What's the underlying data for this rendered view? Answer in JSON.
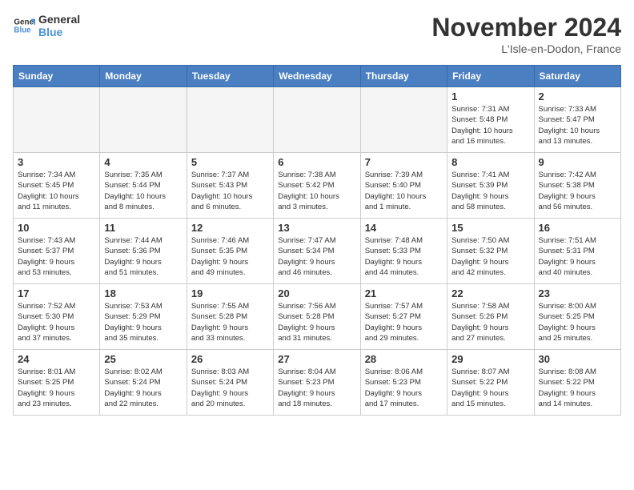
{
  "header": {
    "logo_general": "General",
    "logo_blue": "Blue",
    "month_title": "November 2024",
    "location": "L'Isle-en-Dodon, France"
  },
  "days_of_week": [
    "Sunday",
    "Monday",
    "Tuesday",
    "Wednesday",
    "Thursday",
    "Friday",
    "Saturday"
  ],
  "weeks": [
    [
      {
        "day": "",
        "info": ""
      },
      {
        "day": "",
        "info": ""
      },
      {
        "day": "",
        "info": ""
      },
      {
        "day": "",
        "info": ""
      },
      {
        "day": "",
        "info": ""
      },
      {
        "day": "1",
        "info": "Sunrise: 7:31 AM\nSunset: 5:48 PM\nDaylight: 10 hours\nand 16 minutes."
      },
      {
        "day": "2",
        "info": "Sunrise: 7:33 AM\nSunset: 5:47 PM\nDaylight: 10 hours\nand 13 minutes."
      }
    ],
    [
      {
        "day": "3",
        "info": "Sunrise: 7:34 AM\nSunset: 5:45 PM\nDaylight: 10 hours\nand 11 minutes."
      },
      {
        "day": "4",
        "info": "Sunrise: 7:35 AM\nSunset: 5:44 PM\nDaylight: 10 hours\nand 8 minutes."
      },
      {
        "day": "5",
        "info": "Sunrise: 7:37 AM\nSunset: 5:43 PM\nDaylight: 10 hours\nand 6 minutes."
      },
      {
        "day": "6",
        "info": "Sunrise: 7:38 AM\nSunset: 5:42 PM\nDaylight: 10 hours\nand 3 minutes."
      },
      {
        "day": "7",
        "info": "Sunrise: 7:39 AM\nSunset: 5:40 PM\nDaylight: 10 hours\nand 1 minute."
      },
      {
        "day": "8",
        "info": "Sunrise: 7:41 AM\nSunset: 5:39 PM\nDaylight: 9 hours\nand 58 minutes."
      },
      {
        "day": "9",
        "info": "Sunrise: 7:42 AM\nSunset: 5:38 PM\nDaylight: 9 hours\nand 56 minutes."
      }
    ],
    [
      {
        "day": "10",
        "info": "Sunrise: 7:43 AM\nSunset: 5:37 PM\nDaylight: 9 hours\nand 53 minutes."
      },
      {
        "day": "11",
        "info": "Sunrise: 7:44 AM\nSunset: 5:36 PM\nDaylight: 9 hours\nand 51 minutes."
      },
      {
        "day": "12",
        "info": "Sunrise: 7:46 AM\nSunset: 5:35 PM\nDaylight: 9 hours\nand 49 minutes."
      },
      {
        "day": "13",
        "info": "Sunrise: 7:47 AM\nSunset: 5:34 PM\nDaylight: 9 hours\nand 46 minutes."
      },
      {
        "day": "14",
        "info": "Sunrise: 7:48 AM\nSunset: 5:33 PM\nDaylight: 9 hours\nand 44 minutes."
      },
      {
        "day": "15",
        "info": "Sunrise: 7:50 AM\nSunset: 5:32 PM\nDaylight: 9 hours\nand 42 minutes."
      },
      {
        "day": "16",
        "info": "Sunrise: 7:51 AM\nSunset: 5:31 PM\nDaylight: 9 hours\nand 40 minutes."
      }
    ],
    [
      {
        "day": "17",
        "info": "Sunrise: 7:52 AM\nSunset: 5:30 PM\nDaylight: 9 hours\nand 37 minutes."
      },
      {
        "day": "18",
        "info": "Sunrise: 7:53 AM\nSunset: 5:29 PM\nDaylight: 9 hours\nand 35 minutes."
      },
      {
        "day": "19",
        "info": "Sunrise: 7:55 AM\nSunset: 5:28 PM\nDaylight: 9 hours\nand 33 minutes."
      },
      {
        "day": "20",
        "info": "Sunrise: 7:56 AM\nSunset: 5:28 PM\nDaylight: 9 hours\nand 31 minutes."
      },
      {
        "day": "21",
        "info": "Sunrise: 7:57 AM\nSunset: 5:27 PM\nDaylight: 9 hours\nand 29 minutes."
      },
      {
        "day": "22",
        "info": "Sunrise: 7:58 AM\nSunset: 5:26 PM\nDaylight: 9 hours\nand 27 minutes."
      },
      {
        "day": "23",
        "info": "Sunrise: 8:00 AM\nSunset: 5:25 PM\nDaylight: 9 hours\nand 25 minutes."
      }
    ],
    [
      {
        "day": "24",
        "info": "Sunrise: 8:01 AM\nSunset: 5:25 PM\nDaylight: 9 hours\nand 23 minutes."
      },
      {
        "day": "25",
        "info": "Sunrise: 8:02 AM\nSunset: 5:24 PM\nDaylight: 9 hours\nand 22 minutes."
      },
      {
        "day": "26",
        "info": "Sunrise: 8:03 AM\nSunset: 5:24 PM\nDaylight: 9 hours\nand 20 minutes."
      },
      {
        "day": "27",
        "info": "Sunrise: 8:04 AM\nSunset: 5:23 PM\nDaylight: 9 hours\nand 18 minutes."
      },
      {
        "day": "28",
        "info": "Sunrise: 8:06 AM\nSunset: 5:23 PM\nDaylight: 9 hours\nand 17 minutes."
      },
      {
        "day": "29",
        "info": "Sunrise: 8:07 AM\nSunset: 5:22 PM\nDaylight: 9 hours\nand 15 minutes."
      },
      {
        "day": "30",
        "info": "Sunrise: 8:08 AM\nSunset: 5:22 PM\nDaylight: 9 hours\nand 14 minutes."
      }
    ]
  ]
}
